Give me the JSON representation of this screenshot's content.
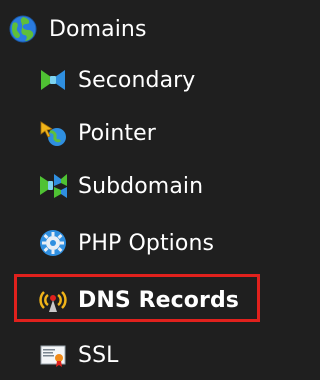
{
  "menu": {
    "parent": {
      "label": "Domains",
      "icon": "globe-icon"
    },
    "items": [
      {
        "label": "Secondary",
        "icon": "bowtie-domains-icon"
      },
      {
        "label": "Pointer",
        "icon": "pointer-arrow-icon"
      },
      {
        "label": "Subdomain",
        "icon": "subdomain-icon"
      },
      {
        "label": "PHP Options",
        "icon": "php-gear-icon"
      },
      {
        "label": "DNS Records",
        "icon": "dns-antenna-icon",
        "highlighted": true
      },
      {
        "label": "SSL",
        "icon": "ssl-certificate-icon"
      }
    ]
  },
  "colors": {
    "background": "#1f1f1f",
    "text": "#ffffff",
    "highlight_border": "#e0211d"
  }
}
